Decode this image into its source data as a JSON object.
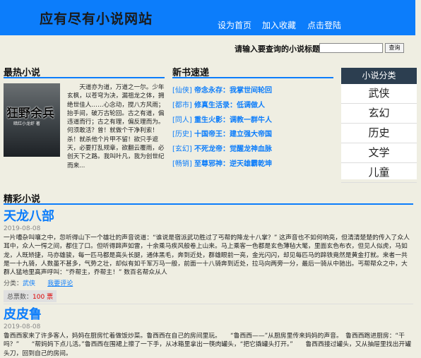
{
  "header": {
    "site_title": "应有尽有小说网站",
    "nav": [
      "设为首页",
      "加入收藏",
      "点击登陆"
    ]
  },
  "search": {
    "label": "请输入要查询的小说标题：",
    "placeholder": "",
    "button": "查询"
  },
  "hot": {
    "heading": "最热小说",
    "cover_title": "狂野余兵",
    "cover_author": "暗红小龙虾 著",
    "description": "天道亦为道，万道之一尔。少年玄枫，以苍穹为决，漏祖龙之体，拥绝世佳人……心念动，搅八方风雨；抬手间，破万古轮回。古之有道，偏违道而行；古之有理，偏反理而为。何须敢活？曾！就做个干净利索！杀！就杀他个片甲不留！欲只手遮天，必要打乱规章，欲翻云覆雨，必创天下之路。我叫叶凡，我为创世纪而来..."
  },
  "new_books": {
    "heading": "新书速递",
    "items": [
      {
        "tag": "[仙侠]",
        "title": "帝念永存：我掌世间轮回"
      },
      {
        "tag": "[都市]",
        "title": "修真生活录：低调做人"
      },
      {
        "tag": "[同人]",
        "title": "重生火影：调教一群牛人"
      },
      {
        "tag": "[历史]",
        "title": "十国帝王：建立强大帝国"
      },
      {
        "tag": "[玄幻]",
        "title": "不死龙帝：觉醒龙神血脉"
      },
      {
        "tag": "[畅销]",
        "title": "至尊邪神：逆天雄霸乾坤"
      }
    ]
  },
  "categories": {
    "heading": "小说分类",
    "items": [
      "武侠",
      "玄幻",
      "历史",
      "文学",
      "儿童"
    ]
  },
  "selected": {
    "heading": "精彩小说",
    "books": [
      {
        "title": "天龙八部",
        "date": "2019-08-08",
        "excerpt": "一片嘈杂叫嚷之中，忽听得山下一个雄壮的声音说道：“谁说是宿派武功胜过了丐帮的降龙十八掌？” 这声音也不如何响亮，但清清楚楚的传入了众人耳中，众人一愕之间，都住了口。但听得蹄声如雷，十余乘马疾风般卷上山来。马上乘客一色都是玄色薄毡大氅，里面玄色布衣，但见人似虎，马如龙，人既矫捷，马亦雄骏，每一匹马都是高头长腿，通体黑毛，奔到近处，群雄眼前一亮，金光闪闪，却见每匹马的蹄铁竟然是黄金打就。来者一共是一十九骑，人数虽不甚多，气势之壮，却似有如千军万马一般，前面一十八骑奔到近处，拉马向两旁一分，最后一骑从中驰出。丐帮帮众之中，大群人猛地里高声呼叫：“乔帮主，乔帮主！” 数百名帮众从人",
        "category_label": "分类：",
        "category": "武侠",
        "review": "我要评论",
        "votes_label": "总票数：",
        "votes": "100",
        "votes_unit": "票"
      },
      {
        "title": "皮皮鲁",
        "date": "2019-08-08",
        "excerpt": "鲁西西家来了许多客人，妈妈在厨房忙着做饭炒菜。鲁西西在自己的房间里玩。　　“鲁西西——”从厨房里传来妈妈的声音。　鲁西西跑进厨房：“干吗？”　　“帮妈妈下点儿活。”鲁西西在围裙上擦了一下手，从冰箱里拿出一筷肉罐头，“把它撬罐头打开。”　　鲁西西接过罐头，又从抽屉里找出开罐头刀，回到自己的房间。"
      }
    ]
  }
}
